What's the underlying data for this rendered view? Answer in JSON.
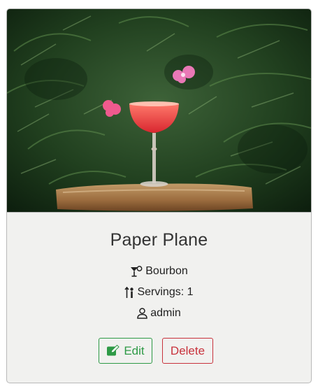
{
  "card": {
    "image_alt": "Paper Plane cocktail",
    "title": "Paper Plane",
    "spirit": "Bourbon",
    "servings": "Servings: 1",
    "author": "admin",
    "edit_label": "Edit",
    "delete_label": "Delete"
  },
  "icons": {
    "spirit": "cocktail-icon",
    "servings": "servings-icon",
    "author": "user-icon",
    "edit": "edit-icon"
  },
  "colors": {
    "edit": "#2e9a46",
    "delete": "#c8323c",
    "card_background": "#f1f1ef"
  }
}
